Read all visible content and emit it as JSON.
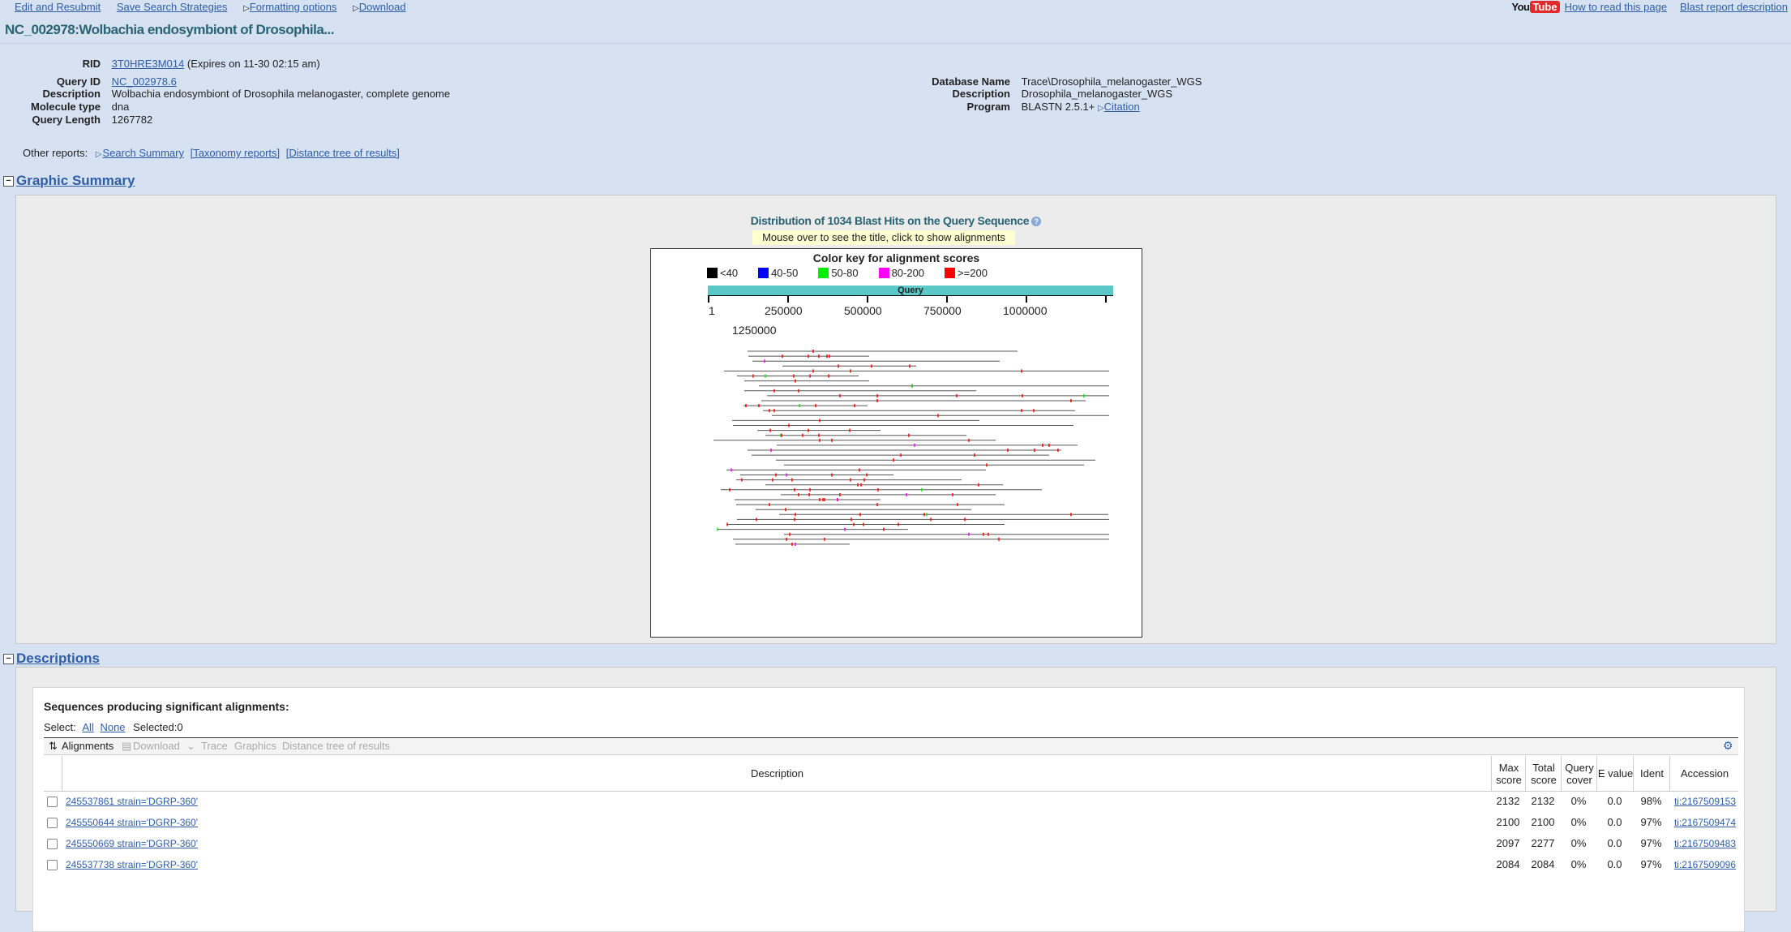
{
  "toplinks": {
    "edit_resubmit": "Edit and Resubmit",
    "save_strategies": "Save Search Strategies",
    "formatting_options": "Formatting options",
    "download": "Download"
  },
  "topright": {
    "yt_you": "You",
    "yt_tube": "Tube",
    "how_to_read": "How to read this page",
    "report_description": "Blast report description"
  },
  "page_title": "NC_002978:Wolbachia endosymbiont of Drosophila...",
  "query_info": {
    "rid_label": "RID",
    "rid_value": "3T0HRE3M014",
    "rid_expires": "(Expires on 11-30 02:15 am)",
    "query_id_label": "Query ID",
    "query_id_value": "NC_002978.6",
    "description_label": "Description",
    "description_value": "Wolbachia endosymbiont of Drosophila melanogaster, complete genome",
    "molecule_type_label": "Molecule type",
    "molecule_type_value": "dna",
    "query_length_label": "Query Length",
    "query_length_value": "1267782"
  },
  "db_info": {
    "database_name_label": "Database Name",
    "database_name_value": "Trace\\Drosophila_melanogaster_WGS",
    "description_label": "Description",
    "description_value": "Drosophila_melanogaster_WGS",
    "program_label": "Program",
    "program_value": "BLASTN 2.5.1+",
    "citation": "Citation"
  },
  "other_reports": {
    "label": "Other reports:",
    "search_summary": "Search Summary",
    "taxonomy_reports": "[Taxonomy reports]",
    "distance_tree": "[Distance tree of results]"
  },
  "graphic_summary": {
    "heading": "Graphic Summary",
    "title": "Distribution of 1034 Blast Hits on the Query Sequence",
    "hint": "Mouse over to see the title, click to show alignments",
    "color_key_title": "Color key for alignment scores",
    "color_key": [
      {
        "label": "<40",
        "color": "#000000"
      },
      {
        "label": "40-50",
        "color": "#0000ff"
      },
      {
        "label": "50-80",
        "color": "#00ee00"
      },
      {
        "label": "80-200",
        "color": "#ff00ff"
      },
      {
        "label": ">=200",
        "color": "#ff0000"
      }
    ],
    "query_label": "Query",
    "ticks": [
      "1",
      "250000",
      "500000",
      "750000",
      "1000000",
      "1250000"
    ]
  },
  "descriptions": {
    "heading": "Descriptions",
    "sequences_heading": "Sequences producing significant alignments:",
    "select_label": "Select:",
    "select_all": "All",
    "select_none": "None",
    "selected_count": "Selected:0",
    "toolbar": {
      "alignments": "Alignments",
      "download": "Download",
      "trace": "Trace",
      "graphics": "Graphics",
      "distance_tree": "Distance tree of results"
    },
    "columns": {
      "description": "Description",
      "max_score": "Max score",
      "total_score": "Total score",
      "query_cover": "Query cover",
      "e_value": "E value",
      "ident": "Ident",
      "accession": "Accession"
    },
    "rows": [
      {
        "description": "245537861 strain='DGRP-360'",
        "max_score": "2132",
        "total_score": "2132",
        "query_cover": "0%",
        "e_value": "0.0",
        "ident": "98%",
        "accession": "ti:2167509153"
      },
      {
        "description": "245550644 strain='DGRP-360'",
        "max_score": "2100",
        "total_score": "2100",
        "query_cover": "0%",
        "e_value": "0.0",
        "ident": "97%",
        "accession": "ti:2167509474"
      },
      {
        "description": "245550669 strain='DGRP-360'",
        "max_score": "2097",
        "total_score": "2277",
        "query_cover": "0%",
        "e_value": "0.0",
        "ident": "97%",
        "accession": "ti:2167509483"
      },
      {
        "description": "245537738 strain='DGRP-360'",
        "max_score": "2084",
        "total_score": "2084",
        "query_cover": "0%",
        "e_value": "0.0",
        "ident": "97%",
        "accession": "ti:2167509096"
      }
    ]
  }
}
